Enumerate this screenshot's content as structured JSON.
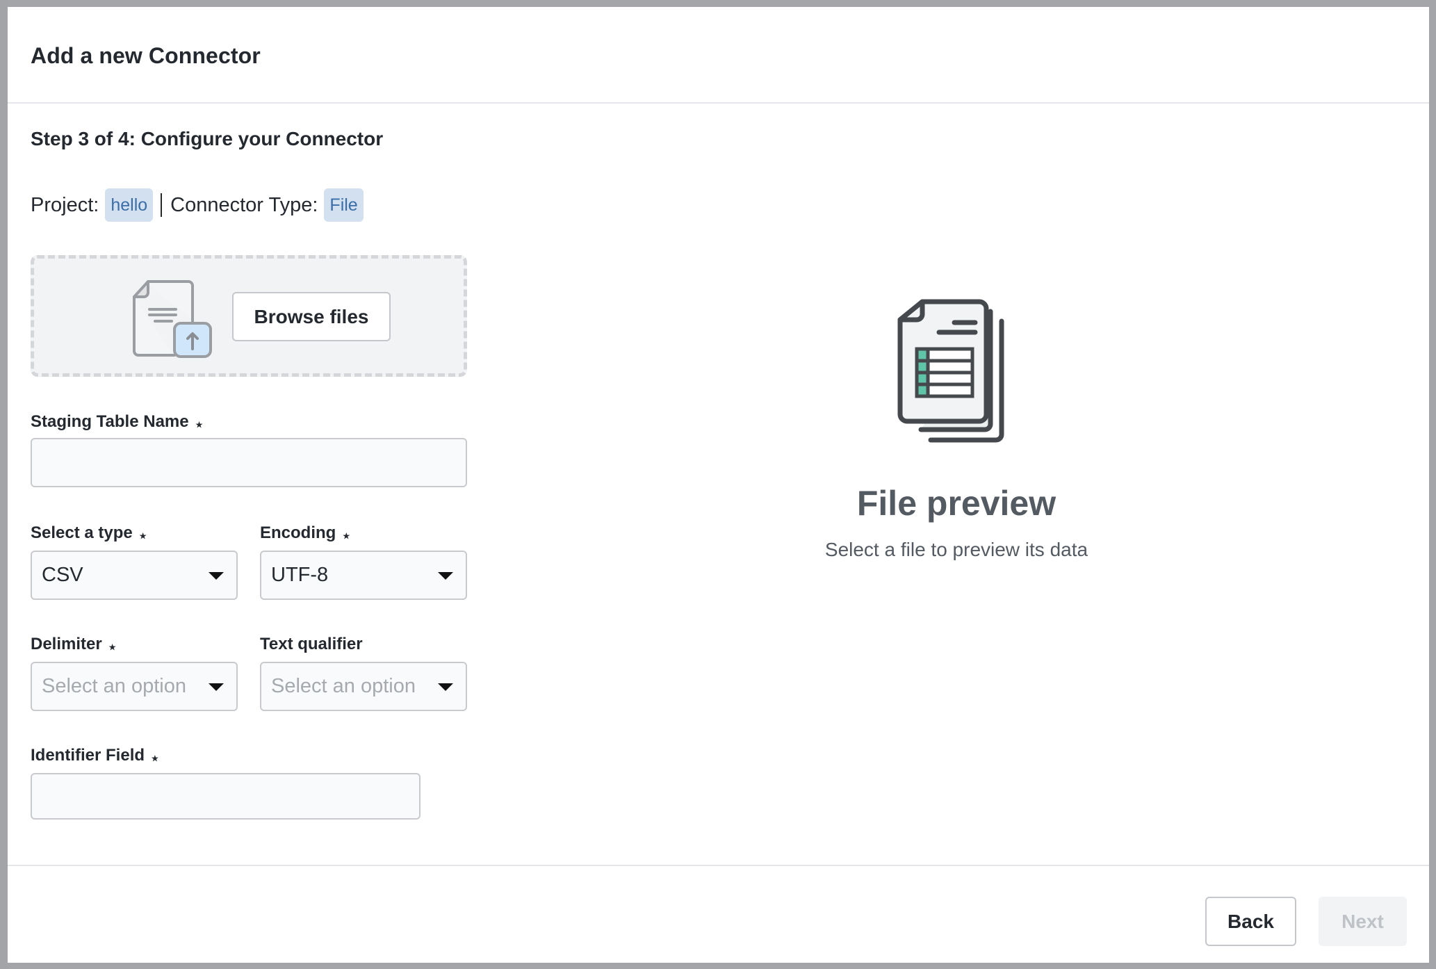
{
  "modal": {
    "title": "Add a new Connector",
    "step_title": "Step 3 of 4: Configure your Connector"
  },
  "meta": {
    "project_label": "Project:",
    "project_value": "hello",
    "connector_type_label": "Connector Type:",
    "connector_type_value": "File"
  },
  "dropzone": {
    "browse_label": "Browse files",
    "icon": "file-upload-icon"
  },
  "form": {
    "required_marker": "⋆",
    "staging_table_name": {
      "label": "Staging Table Name",
      "required": true,
      "value": ""
    },
    "type": {
      "label": "Select a type",
      "required": true,
      "value": "CSV"
    },
    "encoding": {
      "label": "Encoding",
      "required": true,
      "value": "UTF-8"
    },
    "delimiter": {
      "label": "Delimiter",
      "required": true,
      "placeholder": "Select an option"
    },
    "text_qualifier": {
      "label": "Text qualifier",
      "required": false,
      "placeholder": "Select an option"
    },
    "identifier_field": {
      "label": "Identifier Field",
      "required": true,
      "value": ""
    }
  },
  "preview": {
    "icon": "file-spreadsheet-icon",
    "title": "File preview",
    "subtitle": "Select a file to preview its data"
  },
  "footer": {
    "back_label": "Back",
    "next_label": "Next",
    "next_disabled": true
  },
  "colors": {
    "tag_bg": "#d3e0ef",
    "tag_text": "#3b6ea8",
    "accent_green": "#5fc4a8",
    "upload_blue": "#cfe6fb"
  }
}
